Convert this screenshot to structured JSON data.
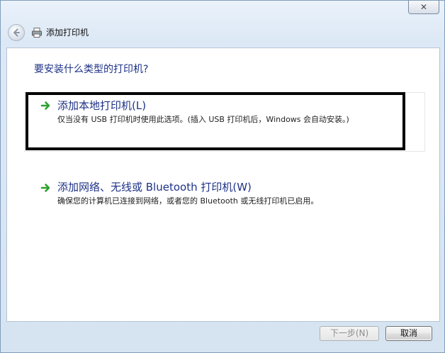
{
  "window": {
    "close_label": "✕"
  },
  "header": {
    "title": "添加打印机"
  },
  "main": {
    "question": "要安装什么类型的打印机?",
    "options": [
      {
        "title": "添加本地打印机(L)",
        "description": "仅当没有 USB 打印机时使用此选项。(插入 USB 打印机后，Windows 会自动安装。)"
      },
      {
        "title": "添加网络、无线或 Bluetooth 打印机(W)",
        "description": "确保您的计算机已连接到网络，或者您的 Bluetooth 或无线打印机已启用。"
      }
    ]
  },
  "footer": {
    "next_label": "下一步(N)",
    "cancel_label": "取消"
  },
  "colors": {
    "link_blue": "#1e3287",
    "arrow_green": "#2ea12e",
    "highlight_border": "#000000"
  },
  "icons": {
    "back": "back-arrow-icon",
    "printer": "printer-icon",
    "option_arrow": "green-arrow-icon"
  }
}
